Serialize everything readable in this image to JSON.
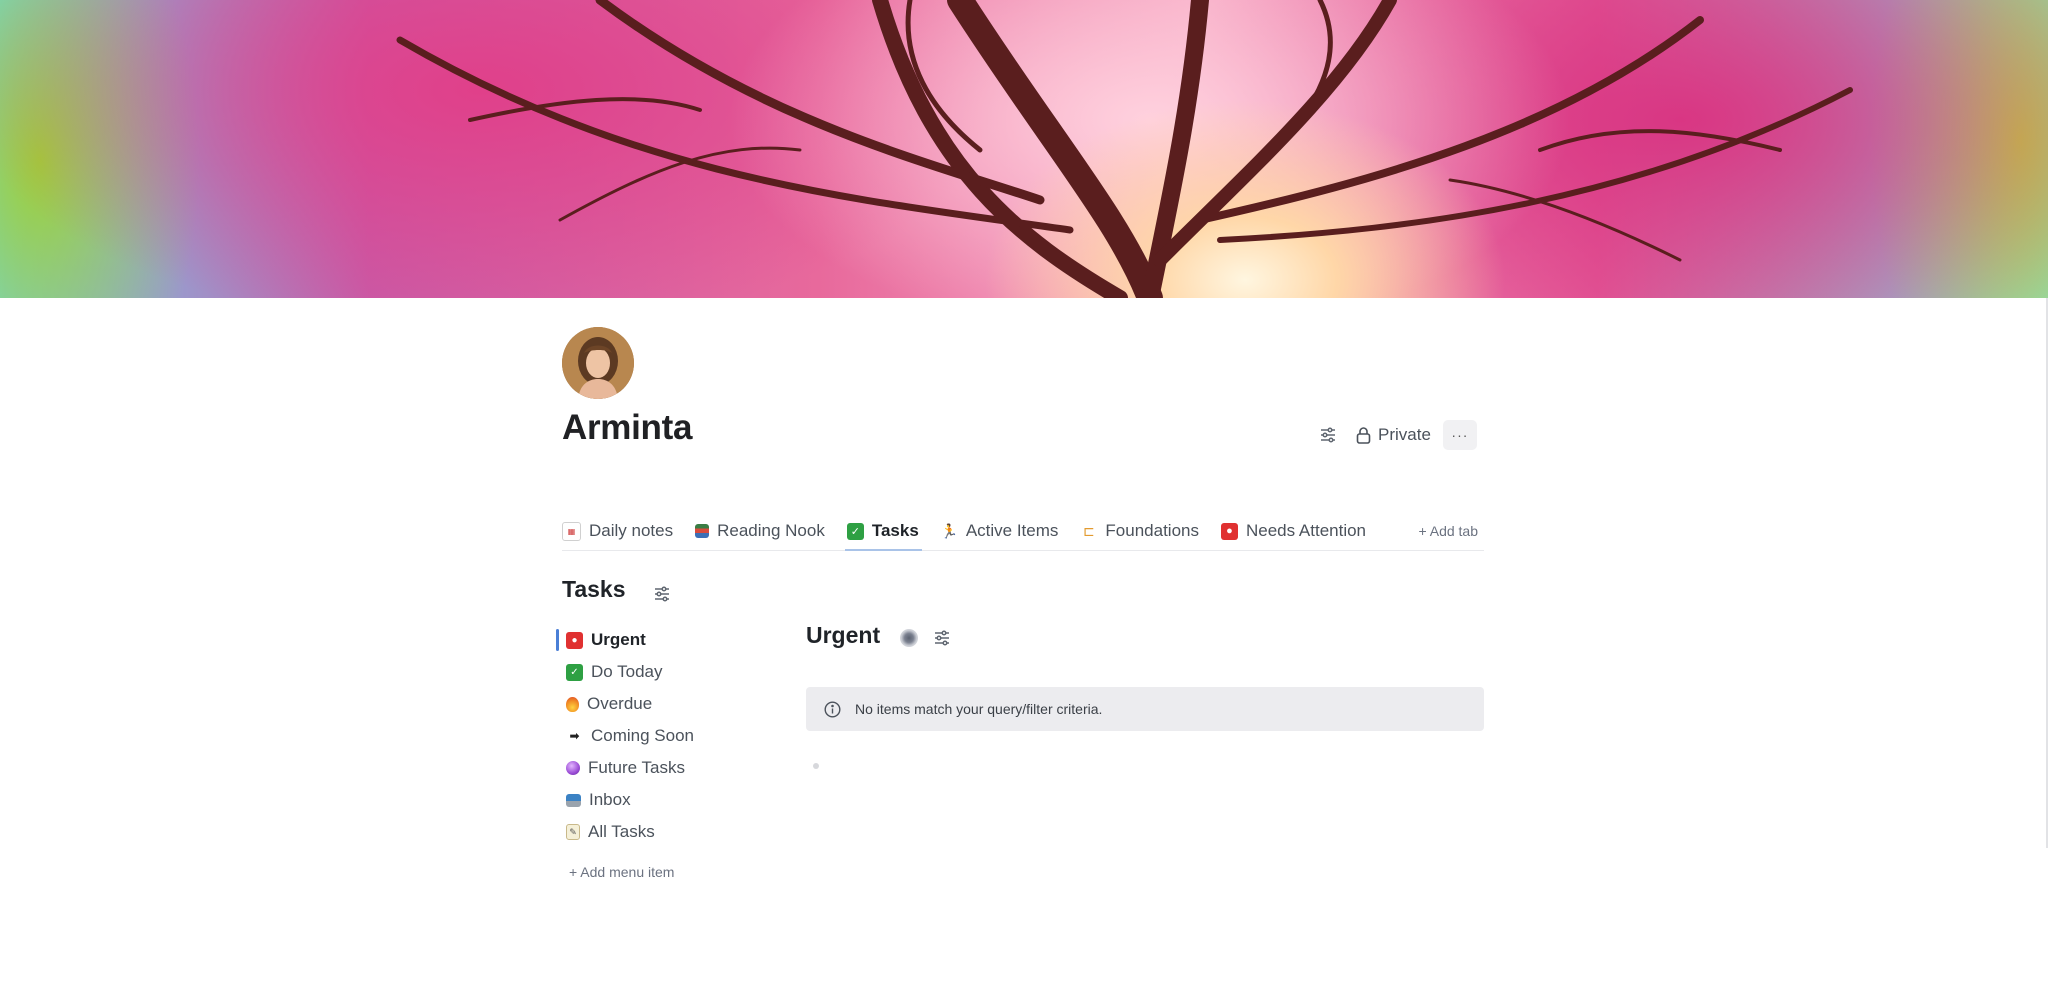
{
  "page": {
    "title": "Arminta",
    "privacy_label": "Private",
    "more_label": "···"
  },
  "tabs": [
    {
      "label": "Daily notes",
      "emoji": "📆",
      "icon": "calendar-icon",
      "active": false
    },
    {
      "label": "Reading Nook",
      "emoji": "📚",
      "icon": "books-icon",
      "active": false
    },
    {
      "label": "Tasks",
      "emoji": "✅",
      "icon": "check-mark-icon",
      "active": true
    },
    {
      "label": "Active Items",
      "emoji": "🏃",
      "icon": "running-person-icon",
      "active": false
    },
    {
      "label": "Foundations",
      "emoji": "🏗",
      "icon": "construction-icon",
      "active": false
    },
    {
      "label": "Needs Attention",
      "emoji": "🚨",
      "icon": "siren-icon",
      "active": false
    }
  ],
  "add_tab_label": "+ Add tab",
  "section": {
    "title": "Tasks"
  },
  "menu": [
    {
      "label": "Urgent",
      "emoji": "🚨",
      "icon": "siren-icon",
      "active": true
    },
    {
      "label": "Do Today",
      "emoji": "✅",
      "icon": "check-mark-icon",
      "active": false
    },
    {
      "label": "Overdue",
      "emoji": "🔥",
      "icon": "fire-icon",
      "active": false
    },
    {
      "label": "Coming Soon",
      "emoji": "🔜",
      "icon": "soon-arrow-icon",
      "active": false
    },
    {
      "label": "Future Tasks",
      "emoji": "🔮",
      "icon": "crystal-ball-icon",
      "active": false
    },
    {
      "label": "Inbox",
      "emoji": "📥",
      "icon": "inbox-tray-icon",
      "active": false
    },
    {
      "label": "All Tasks",
      "emoji": "📝",
      "icon": "memo-icon",
      "active": false
    }
  ],
  "add_menu_label": "+ Add menu item",
  "view": {
    "title": "Urgent",
    "empty_message": "No items match your query/filter criteria."
  },
  "colors": {
    "accent": "#4a7fd6",
    "tab_underline": "#a9c3e8",
    "notice_bg": "#ececef"
  }
}
